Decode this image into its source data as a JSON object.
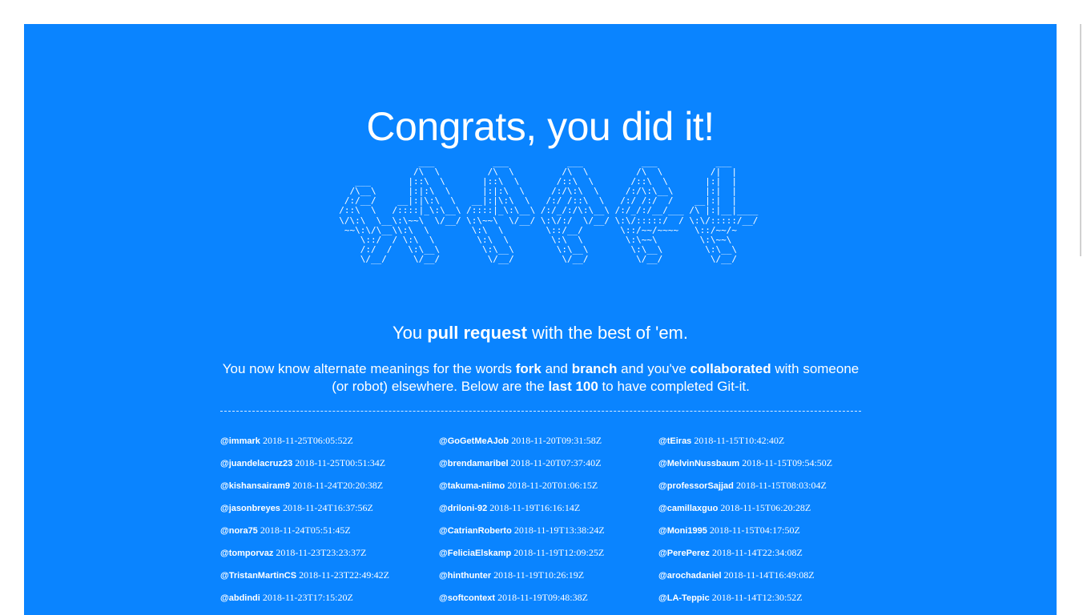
{
  "page": {
    "title": "Congrats, you did it!",
    "ascii_art": "                 ___           ___           ___           ___           ___     \n                /\\  \\         /\\  \\         /\\  \\         /\\  \\         /|  |    \n     ___       |::\\  \\       |::\\  \\       /::\\  \\       /::\\  \\       |:|  |    \n    /\\__\\      |:|:\\  \\      |:|:\\  \\     /:/\\:\\  \\     /:/\\:\\__\\      |:|  |    \n   /:/__/    __|:|\\:\\  \\   __|:|\\:\\  \\   /:/ /::\\  \\   /:/ /:/  /    __|:|  |    \n  /::\\  \\   /::::|_\\:\\__\\ /::::|_\\:\\__\\ /:/_/:/\\:\\__\\ /:/_/:/__/___ /\\ |:|__|____\n  \\/\\:\\  \\__\\:\\~~\\  \\/__/ \\:\\~~\\  \\/__/ \\:\\/:/  \\/__/ \\:\\/:::::/  / \\:\\/:::::/__/\n   ~~\\:\\/\\__\\\\:\\  \\        \\:\\  \\        \\::/__/       \\::/~~/~~~~   \\::/~~/~    \n      \\::/  / \\:\\  \\        \\:\\  \\        \\:\\  \\        \\:\\~~\\        \\:\\~~\\     \n      /:/  /   \\:\\__\\        \\:\\__\\        \\:\\__\\        \\:\\__\\        \\:\\__\\    \n      \\/__/     \\/__/         \\/__/         \\/__/         \\/__/         \\/__/    ",
    "tagline": {
      "pre": "You ",
      "bold": "pull request",
      "post": " with the best of 'em."
    },
    "intro": {
      "t1": "You now know alternate meanings for the words ",
      "b1": "fork",
      "t2": " and ",
      "b2": "branch",
      "t3": " and you've ",
      "b3": "collaborated",
      "t4": " with someone (or robot) elsewhere. Below are the ",
      "b4": "last 100",
      "t5": " to have completed Git-it."
    },
    "committers": [
      {
        "handle": "@immark",
        "time": "2018-11-25T06:05:52Z"
      },
      {
        "handle": "@GoGetMeAJob",
        "time": "2018-11-20T09:31:58Z"
      },
      {
        "handle": "@tEiras",
        "time": "2018-11-15T10:42:40Z"
      },
      {
        "handle": "@juandelacruz23",
        "time": "2018-11-25T00:51:34Z"
      },
      {
        "handle": "@brendamaribel",
        "time": "2018-11-20T07:37:40Z"
      },
      {
        "handle": "@MelvinNussbaum",
        "time": "2018-11-15T09:54:50Z"
      },
      {
        "handle": "@kishansairam9",
        "time": "2018-11-24T20:20:38Z"
      },
      {
        "handle": "@takuma-niimo",
        "time": "2018-11-20T01:06:15Z"
      },
      {
        "handle": "@professorSajjad",
        "time": "2018-11-15T08:03:04Z"
      },
      {
        "handle": "@jasonbreyes",
        "time": "2018-11-24T16:37:56Z"
      },
      {
        "handle": "@driloni-92",
        "time": "2018-11-19T16:16:14Z"
      },
      {
        "handle": "@camillaxguo",
        "time": "2018-11-15T06:20:28Z"
      },
      {
        "handle": "@nora75",
        "time": "2018-11-24T05:51:45Z"
      },
      {
        "handle": "@CatrianRoberto",
        "time": "2018-11-19T13:38:24Z"
      },
      {
        "handle": "@Moni1995",
        "time": "2018-11-15T04:17:50Z"
      },
      {
        "handle": "@tomporvaz",
        "time": "2018-11-23T23:23:37Z"
      },
      {
        "handle": "@FeliciaElskamp",
        "time": "2018-11-19T12:09:25Z"
      },
      {
        "handle": "@PerePerez",
        "time": "2018-11-14T22:34:08Z"
      },
      {
        "handle": "@TristanMartinCS",
        "time": "2018-11-23T22:49:42Z"
      },
      {
        "handle": "@hinthunter",
        "time": "2018-11-19T10:26:19Z"
      },
      {
        "handle": "@arochadaniel",
        "time": "2018-11-14T16:49:08Z"
      },
      {
        "handle": "@abdindi",
        "time": "2018-11-23T17:15:20Z"
      },
      {
        "handle": "@softcontext",
        "time": "2018-11-19T09:48:38Z"
      },
      {
        "handle": "@LA-Teppic",
        "time": "2018-11-14T12:30:52Z"
      }
    ]
  },
  "colors": {
    "panel_background": "#0a84ff",
    "page_background": "#ffffff",
    "text": "#ffffff"
  }
}
